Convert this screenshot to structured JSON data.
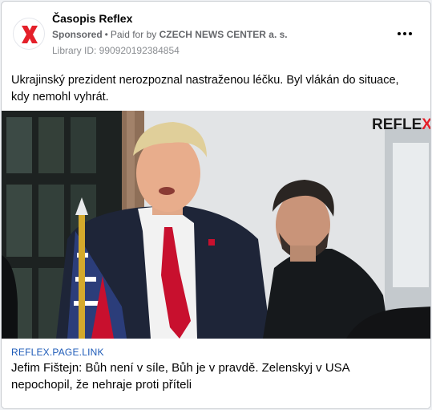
{
  "post": {
    "page_name": "Časopis Reflex",
    "sponsored_label": "Sponsored",
    "separator": "•",
    "paid_for_prefix": "Paid for by",
    "advertiser": "CZECH NEWS CENTER a. s.",
    "library_id_text": "Library ID: 990920192384854",
    "body_text": "Ukrajinský prezident nerozpoznal nastraženou léčku. Byl vlákán do situace, kdy nemohl vyhrát."
  },
  "image": {
    "brand_prefix": "REFLE",
    "brand_suffix": "X"
  },
  "link": {
    "domain": "REFLEX.PAGE.LINK",
    "headline": "Jefim Fištejn: Bůh není v síle, Bůh je v pravdě. Zelenskyj v USA nepochopil, že nehraje proti příteli"
  },
  "icons": {
    "logo": "reflex-x-logo-icon",
    "more": "more-options-icon"
  },
  "colors": {
    "brand_red": "#e4202a",
    "link_blue": "#1e5bb8",
    "text_gray": "#65676b"
  }
}
